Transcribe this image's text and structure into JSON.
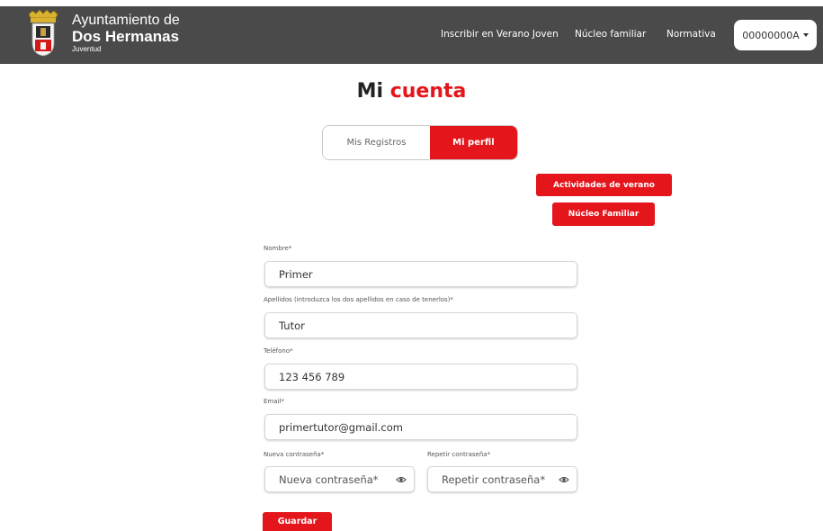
{
  "header": {
    "brand_line1": "Ayuntamiento de",
    "brand_line2": "Dos Hermanas",
    "brand_line3": "Juventud",
    "nav": [
      "Inscribir en Verano Joven",
      "Núcleo familiar",
      "Normativa"
    ],
    "user_id": "00000000A"
  },
  "page": {
    "title_part1": "Mi",
    "title_part2": "cuenta"
  },
  "tabs": [
    {
      "label": "Mis Registros",
      "active": false
    },
    {
      "label": "Mi perfil",
      "active": true
    }
  ],
  "actions": {
    "actividades": "Actividades de verano",
    "nucleo": "Núcleo Familiar"
  },
  "form": {
    "nombre_label": "Nombre*",
    "nombre_value": "Primer",
    "apellidos_label": "Apellidos (introduzca los dos apellidos en caso de tenerlos)*",
    "apellidos_value": "Tutor",
    "telefono_label": "Teléfono*",
    "telefono_value": "123 456 789",
    "email_label": "Email*",
    "email_value": "primertutor@gmail.com",
    "password_label": "Nueva contraseña*",
    "password_placeholder": "Nueva contraseña*",
    "repeat_label": "Repetir contraseña*",
    "repeat_placeholder": "Repetir contraseña*",
    "save_label": "Guardar"
  },
  "colors": {
    "accent": "#e4151b",
    "header_bg": "#4a4a4a"
  }
}
